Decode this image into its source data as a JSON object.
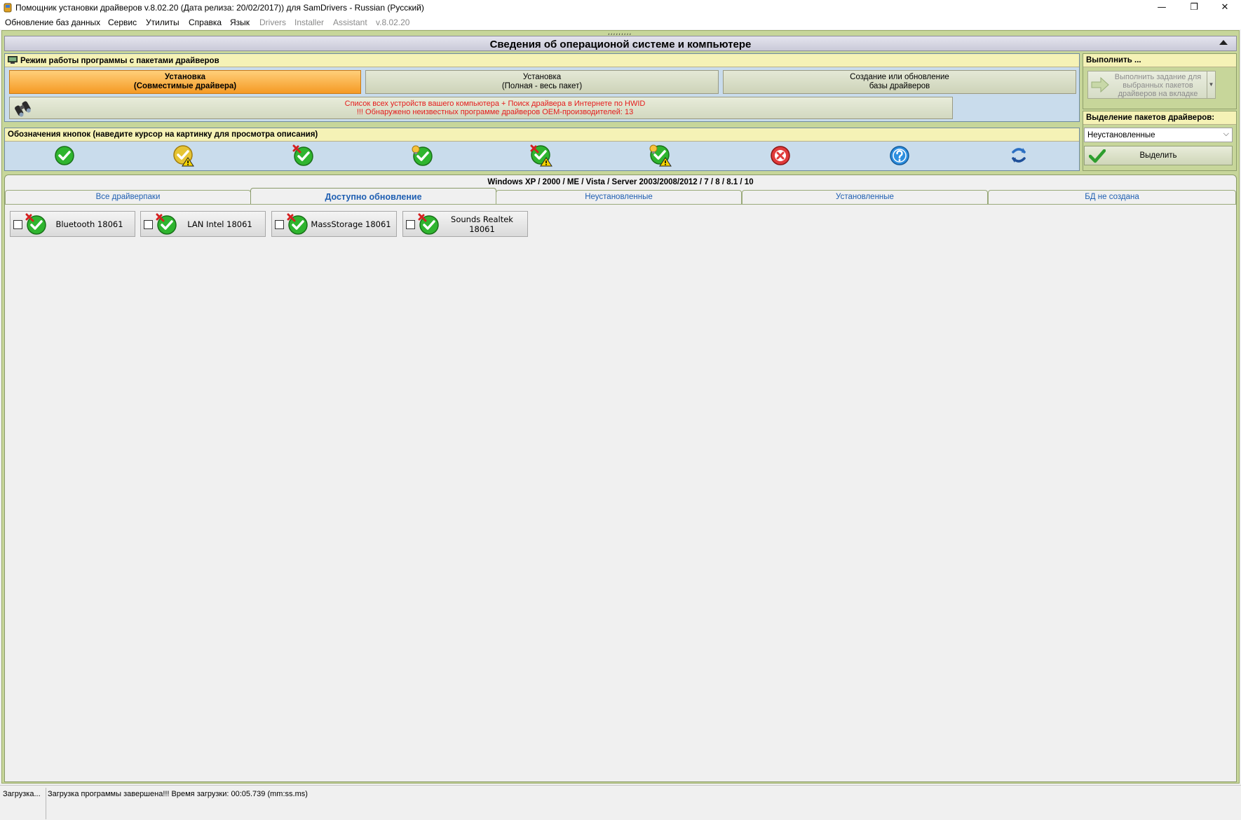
{
  "window": {
    "title": "Помощник установки драйверов v.8.02.20 (Дата релиза: 20/02/2017)) для SamDrivers - Russian (Русский)",
    "controls": {
      "minimize": "—",
      "restore": "❐",
      "close": "✕"
    }
  },
  "menu": [
    {
      "label": "Обновление баз данных",
      "enabled": true
    },
    {
      "label": "Сервис",
      "enabled": true
    },
    {
      "label": "Утилиты",
      "enabled": true
    },
    {
      "label": "Справка",
      "enabled": true
    },
    {
      "label": "Язык",
      "enabled": true
    },
    {
      "label": "Drivers",
      "enabled": false
    },
    {
      "label": "Installer",
      "enabled": false
    },
    {
      "label": "Assistant",
      "enabled": false
    },
    {
      "label": "v.8.02.20",
      "enabled": false
    }
  ],
  "grip": ",,,,,,,,,",
  "section": {
    "title": "Сведения об операционой системе и компьютере"
  },
  "mode_panel": {
    "title": "Режим работы программы с пакетами драйверов",
    "buttons": [
      {
        "line1": "Установка",
        "line2": "(Совместимые драйвера)",
        "active": true
      },
      {
        "line1": "Установка",
        "line2": "(Полная - весь пакет)",
        "active": false
      },
      {
        "line1": "Создание или обновление",
        "line2": "базы драйверов",
        "active": false
      }
    ],
    "hwid_line1": "Список всех устройств вашего компьютера + Поиск драйвера в Интернете по HWID",
    "hwid_line2": "!!! Обнаружено неизвестных программе драйверов OEM-производителей: 13"
  },
  "legend_panel": {
    "title": "Обозначения кнопок (наведите курсор на картинку для просмотра описания)",
    "icons": [
      "check-icon",
      "warning-check-icon",
      "update-check-icon",
      "bulb-check-icon",
      "update-warning-icon",
      "bulb-warning-icon",
      "error-icon",
      "help-icon",
      "refresh-icon"
    ]
  },
  "execute_panel": {
    "title": "Выполнить ...",
    "button_label": "Выполнить задание для выбранных пакетов драйверов на вкладке",
    "dropdown_arrow": "▼"
  },
  "selection_panel": {
    "title": "Выделение пакетов драйверов:",
    "combo_value": "Неустановленные",
    "combo_arrow": "⌵",
    "button_label": "Выделить"
  },
  "os_label": "Windows XP / 2000 / ME / Vista / Server 2003/2008/2012 / 7 / 8 / 8.1 / 10",
  "tabs": [
    {
      "label": "Все драйверпаки",
      "active": false
    },
    {
      "label": "Доступно обновление",
      "active": true
    },
    {
      "label": "Неустановленные",
      "active": false
    },
    {
      "label": "Установленные",
      "active": false
    },
    {
      "label": "БД не создана",
      "active": false
    }
  ],
  "packages": [
    {
      "label": "Bluetooth 18061",
      "checked": false
    },
    {
      "label": "LAN Intel 18061",
      "checked": false
    },
    {
      "label": "MassStorage 18061",
      "checked": false
    },
    {
      "label": "Sounds Realtek 18061",
      "checked": false
    }
  ],
  "status": {
    "left": "Загрузка...",
    "message": "Загрузка программы завершена!!! Время загрузки: 00:05.739 (mm:ss.ms)"
  },
  "colors": {
    "frame": "#c7d69a",
    "panel_header": "#f5f2b6",
    "panel_body": "#c9dcec",
    "active_mode": "#f59a24",
    "alert_text": "#e41b1b",
    "tab_text": "#1f5fb2"
  }
}
